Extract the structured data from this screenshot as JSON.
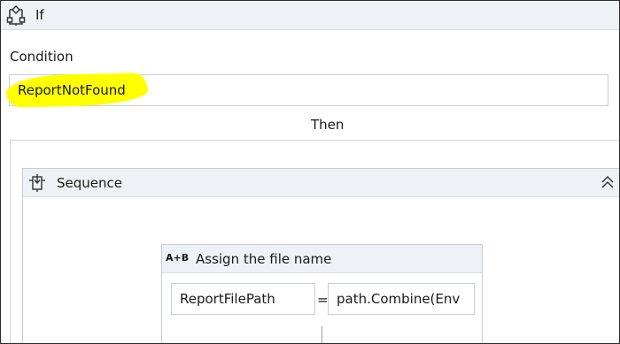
{
  "if_activity": {
    "title": "If",
    "icon": "if-activity-icon",
    "condition_label": "Condition",
    "condition_value": "ReportNotFound",
    "highlight_color": "#ffff00",
    "then_label": "Then"
  },
  "sequence": {
    "title": "Sequence",
    "icon": "sequence-icon",
    "collapse_icon": "collapse-chevrons-icon"
  },
  "assign": {
    "icon_text": "A+B",
    "title": "Assign the file name",
    "to": "ReportFilePath",
    "operator": "=",
    "value": "path.Combine(Env"
  }
}
